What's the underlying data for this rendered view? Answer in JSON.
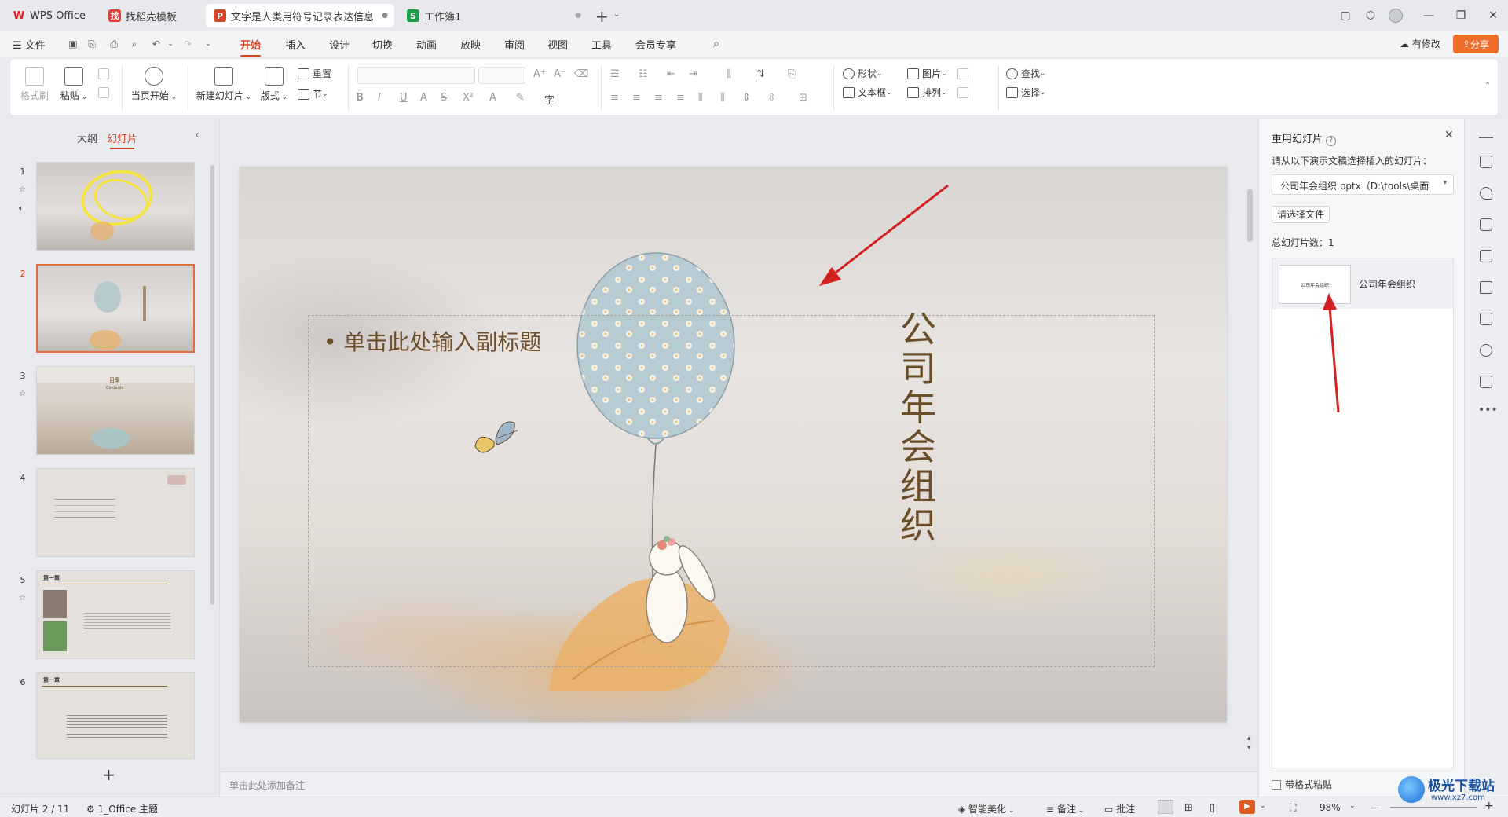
{
  "tabs": [
    {
      "label": "WPS Office",
      "icon": "wps-logo-icon",
      "color": "#e02020"
    },
    {
      "label": "找稻壳模板",
      "icon": "docer-icon",
      "color": "#e0403a"
    },
    {
      "label": "文字是人类用符号记录表达信息以",
      "icon": "ppt-icon",
      "color": "#d24726"
    },
    {
      "label": "工作簿1",
      "icon": "sheet-icon",
      "color": "#1e9e4a"
    }
  ],
  "tab_new": "+",
  "menu": {
    "file": "文件",
    "items": [
      "开始",
      "插入",
      "设计",
      "切换",
      "动画",
      "放映",
      "审阅",
      "视图",
      "工具",
      "会员专享"
    ],
    "active": "开始",
    "has_changes": "有修改",
    "share": "分享"
  },
  "ribbon": {
    "format_painter": "格式刷",
    "paste": "粘贴",
    "play_from_current": "当页开始",
    "new_slide": "新建幻灯片",
    "layout": "版式",
    "reset": "重置",
    "section": "节",
    "shape": "形状",
    "picture": "图片",
    "textbox": "文本框",
    "arrange": "排列",
    "find": "查找",
    "select": "选择"
  },
  "left_panel": {
    "tab_outline": "大纲",
    "tab_slides": "幻灯片",
    "add": "+",
    "slides": [
      {
        "num": "1",
        "icons": [
          "star-icon",
          "sound-icon"
        ]
      },
      {
        "num": "2",
        "selected": true
      },
      {
        "num": "3",
        "icons": [
          "star-icon"
        ]
      },
      {
        "num": "4"
      },
      {
        "num": "5",
        "icons": [
          "star-icon"
        ]
      },
      {
        "num": "6"
      }
    ],
    "thumb_texts": {
      "t3_title": "目录",
      "t3_sub": "Contents",
      "t5_title": "第一章",
      "t6_title": "第一章"
    }
  },
  "slide": {
    "subtitle_placeholder": "单击此处输入副标题",
    "title": "公司年会组织"
  },
  "notes_placeholder": "单击此处添加备注",
  "reuse_pane": {
    "title": "重用幻灯片",
    "instruction": "请从以下演示文稿选择插入的幻灯片：",
    "file": "公司年会组织.pptx（D:\\tools\\桌面",
    "choose_file": "请选择文件",
    "total": "总幻灯片数：1",
    "item_label": "公司年会组织",
    "item_thumb_text": "公司年会组织",
    "keep_format": "带格式粘贴"
  },
  "status": {
    "slide_pos": "幻灯片 2 / 11",
    "theme": "1_Office 主题",
    "beautify": "智能美化",
    "notes": "备注",
    "comment": "批注",
    "zoom": "98%"
  },
  "watermark": {
    "site": "极光下载站",
    "url": "www.xz7.com"
  },
  "colors": {
    "accent": "#d24726",
    "share_bg": "#ef6c2a",
    "arrow": "#d32020",
    "title_text": "#6a4e2a"
  }
}
